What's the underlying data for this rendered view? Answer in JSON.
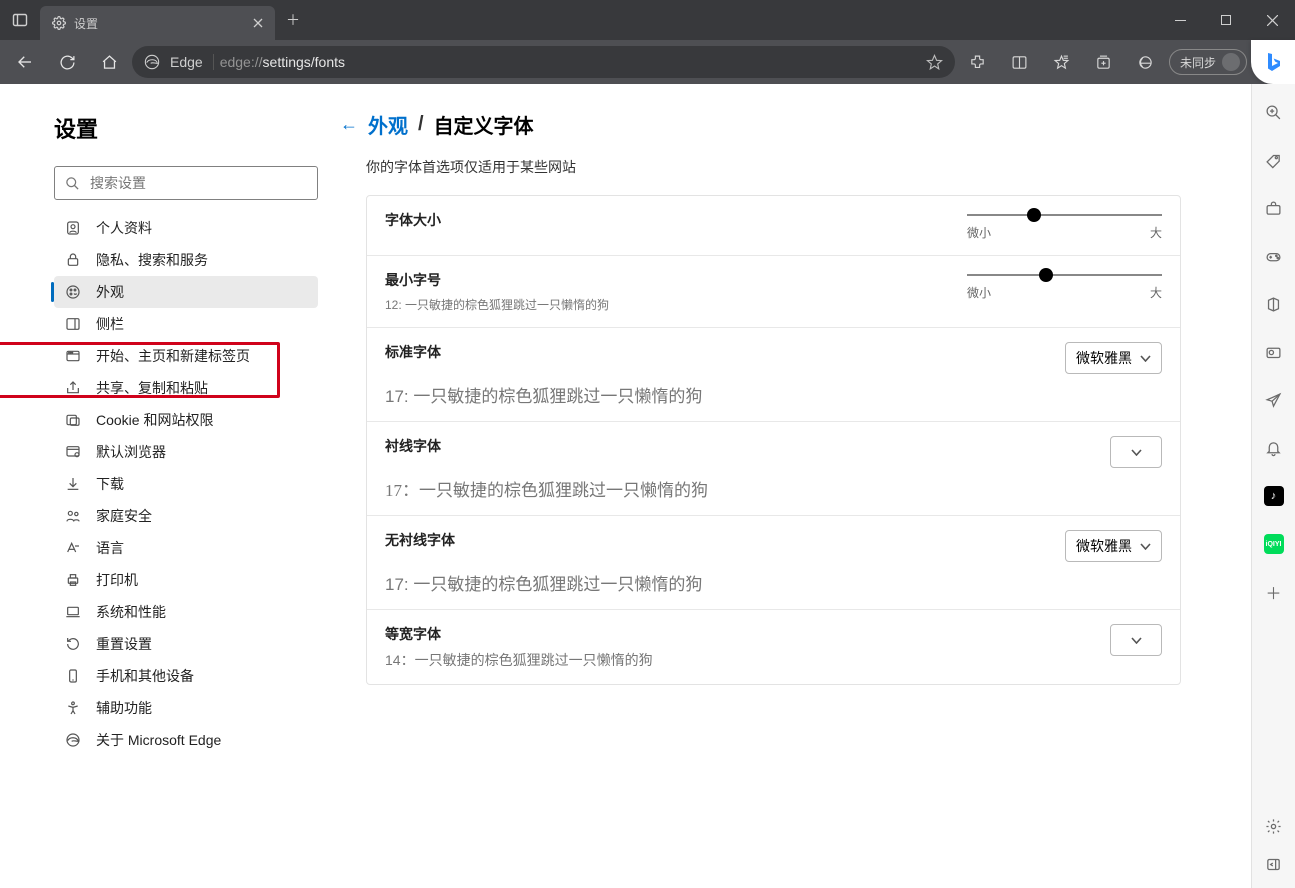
{
  "window": {
    "tab_title": "设置",
    "sync_label": "未同步"
  },
  "addr": {
    "product": "Edge",
    "url_scheme": "edge://",
    "url_path": "settings/fonts"
  },
  "sidebar": {
    "title": "设置",
    "search_placeholder": "搜索设置",
    "items": [
      {
        "label": "个人资料"
      },
      {
        "label": "隐私、搜索和服务"
      },
      {
        "label": "外观"
      },
      {
        "label": "侧栏"
      },
      {
        "label": "开始、主页和新建标签页"
      },
      {
        "label": "共享、复制和粘贴"
      },
      {
        "label": "Cookie 和网站权限"
      },
      {
        "label": "默认浏览器"
      },
      {
        "label": "下载"
      },
      {
        "label": "家庭安全"
      },
      {
        "label": "语言"
      },
      {
        "label": "打印机"
      },
      {
        "label": "系统和性能"
      },
      {
        "label": "重置设置"
      },
      {
        "label": "手机和其他设备"
      },
      {
        "label": "辅助功能"
      },
      {
        "label": "关于 Microsoft Edge"
      }
    ]
  },
  "main": {
    "breadcrumb_parent": "外观",
    "breadcrumb_current": "自定义字体",
    "subtitle": "你的字体首选项仅适用于某些网站",
    "rows": {
      "font_size": {
        "title": "字体大小",
        "min": "微小",
        "max": "大"
      },
      "min_size": {
        "title": "最小字号",
        "desc": "12: 一只敏捷的棕色狐狸跳过一只懒惰的狗",
        "min": "微小",
        "max": "大"
      },
      "standard": {
        "title": "标准字体",
        "dropdown": "微软雅黑",
        "sample": "17: 一只敏捷的棕色狐狸跳过一只懒惰的狗"
      },
      "serif": {
        "title": "衬线字体",
        "sample": "17：一只敏捷的棕色狐狸跳过一只懒惰的狗"
      },
      "sans": {
        "title": "无衬线字体",
        "dropdown": "微软雅黑",
        "sample": "17: 一只敏捷的棕色狐狸跳过一只懒惰的狗"
      },
      "mono": {
        "title": "等宽字体",
        "desc": "14：一只敏捷的棕色狐狸跳过一只懒惰的狗"
      }
    }
  }
}
